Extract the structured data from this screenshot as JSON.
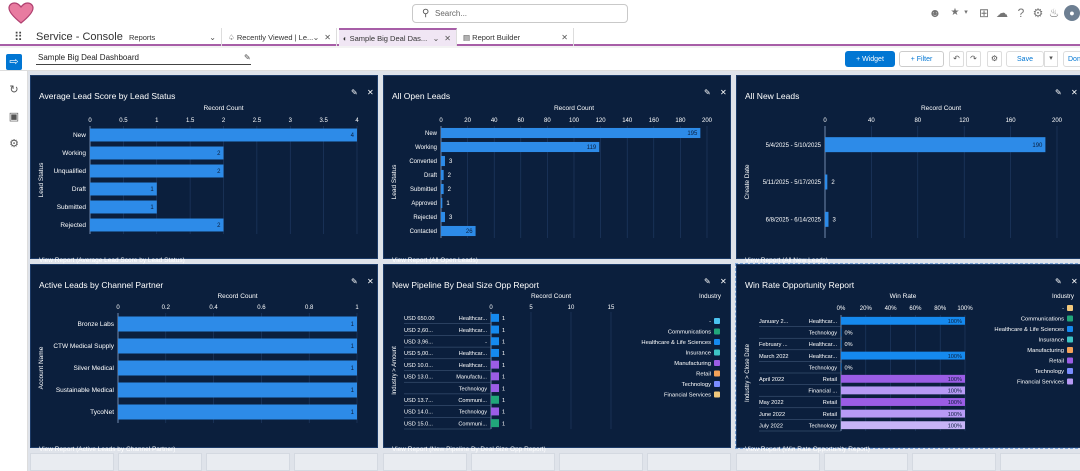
{
  "global": {
    "search_placeholder": "Search..."
  },
  "nav": {
    "app_name": "Service - Console",
    "tabs": [
      {
        "label": "Reports",
        "active": false
      },
      {
        "label": "Recently Viewed | Le...",
        "active": false
      },
      {
        "label": "Sample Big Deal Das...",
        "active": true
      },
      {
        "label": "Report Builder",
        "active": false
      }
    ]
  },
  "header": {
    "dashboard_title": "Sample Big Deal Dashboard",
    "widget_label": "+ Widget",
    "filter_label": "+ Filter",
    "save_label": "Save",
    "done_label": "Done"
  },
  "widgets": {
    "w1": {
      "title": "Average Lead Score by Lead Status",
      "link": "View Report (Average Lead Score by Lead Status)",
      "chart_data": {
        "type": "bar",
        "orientation": "horizontal",
        "xlabel": "Record Count",
        "ylabel": "Lead Status",
        "xlim": [
          0,
          4
        ],
        "ticks": [
          "0",
          "0.5",
          "1",
          "1.5",
          "2",
          "2.5",
          "3",
          "3.5",
          "4"
        ],
        "categories": [
          "New",
          "Working",
          "Unqualified",
          "Draft",
          "Submitted",
          "Rejected"
        ],
        "values": [
          4,
          2,
          2,
          1,
          1,
          2
        ]
      }
    },
    "w2": {
      "title": "All Open Leads",
      "link": "View Report (All Open Leads)",
      "chart_data": {
        "type": "bar",
        "orientation": "horizontal",
        "xlabel": "Record Count",
        "ylabel": "Lead Status",
        "xlim": [
          0,
          200
        ],
        "ticks": [
          "0",
          "20",
          "40",
          "60",
          "80",
          "100",
          "120",
          "140",
          "160",
          "180",
          "200"
        ],
        "categories": [
          "New",
          "Working",
          "Converted",
          "Draft",
          "Submitted",
          "Approved",
          "Rejected",
          "Contacted"
        ],
        "values": [
          195,
          119,
          3,
          2,
          2,
          1,
          3,
          26
        ]
      }
    },
    "w3": {
      "title": "All New Leads",
      "link": "View Report (All New Leads)",
      "chart_data": {
        "type": "bar",
        "orientation": "horizontal",
        "xlabel": "Record Count",
        "ylabel": "Create Date",
        "xlim": [
          0,
          200
        ],
        "ticks": [
          "0",
          "40",
          "80",
          "120",
          "160",
          "200"
        ],
        "categories": [
          "5/4/2025 - 5/10/2025",
          "5/11/2025 - 5/17/2025",
          "6/8/2025 - 6/14/2025"
        ],
        "values": [
          190,
          2,
          3
        ]
      }
    },
    "w4": {
      "title": "Active Leads by Channel Partner",
      "link": "View Report (Active Leads by Channel Partner)",
      "chart_data": {
        "type": "bar",
        "orientation": "horizontal",
        "xlabel": "Record Count",
        "ylabel": "Account Name",
        "xlim": [
          0,
          1
        ],
        "ticks": [
          "0",
          "0.2",
          "0.4",
          "0.6",
          "0.8",
          "1"
        ],
        "categories": [
          "Bronze Labs",
          "CTW Medical Supply",
          "Silver Medical",
          "Sustainable Medical",
          "TycoNet"
        ],
        "values": [
          1,
          1,
          1,
          1,
          1
        ]
      }
    },
    "w5": {
      "title": "New Pipeline By Deal Size Opp Report",
      "link": "View Report (New Pipeline By Deal Size Opp Report)",
      "chart_data": {
        "type": "bar",
        "orientation": "horizontal",
        "stacked": true,
        "xlabel": "Record Count",
        "ylabel": "Industry > Amount",
        "xlim": [
          0,
          15
        ],
        "ticks": [
          "0",
          "5",
          "10",
          "15"
        ],
        "rows": [
          {
            "amount": "USD 650.00",
            "industry": "Healthcar...",
            "value": 1,
            "color": "#1589ee"
          },
          {
            "amount": "USD 2,60...",
            "industry": "Healthcar...",
            "value": 1,
            "color": "#1589ee"
          },
          {
            "amount": "USD 3,96...",
            "industry": "-",
            "value": 1,
            "color": "#1589ee"
          },
          {
            "amount": "USD 5,00...",
            "industry": "Healthcar...",
            "value": 1,
            "color": "#1589ee"
          },
          {
            "amount": "USD 10.0...",
            "industry": "Healthcar...",
            "value": 1,
            "color": "#9b5de5"
          },
          {
            "amount": "USD 13.0...",
            "industry": "Manufactu...",
            "value": 1,
            "color": "#9b5de5"
          },
          {
            "amount": "",
            "industry": "Technology",
            "value": 1,
            "color": "#9b5de5"
          },
          {
            "amount": "USD 13.7...",
            "industry": "Communi...",
            "value": 1,
            "color": "#21a67a"
          },
          {
            "amount": "USD 14.0...",
            "industry": "Technology",
            "value": 1,
            "color": "#9b5de5"
          },
          {
            "amount": "USD 15.0...",
            "industry": "Communi...",
            "value": 1,
            "color": "#21a67a"
          }
        ],
        "legend_title": "Industry",
        "legend": [
          {
            "name": "-",
            "color": "#4bc3f0"
          },
          {
            "name": "Communications",
            "color": "#21a67a"
          },
          {
            "name": "Healthcare & Life Sciences",
            "color": "#1589ee"
          },
          {
            "name": "Insurance",
            "color": "#3ec5c5"
          },
          {
            "name": "Manufacturing",
            "color": "#9b5de5"
          },
          {
            "name": "Retail",
            "color": "#f4a259"
          },
          {
            "name": "Technology",
            "color": "#7b8cff"
          },
          {
            "name": "Financial Services",
            "color": "#f2c97d"
          }
        ]
      }
    },
    "w6": {
      "title": "Win Rate Opportunity Report",
      "link": "View Report (Win Rate Opportunity Report)",
      "chart_data": {
        "type": "bar",
        "orientation": "horizontal",
        "xlabel": "Win Rate",
        "ylabel": "Industry > Close Date",
        "xlim": [
          0,
          100
        ],
        "ticks": [
          "0%",
          "20%",
          "40%",
          "60%",
          "80%",
          "100%"
        ],
        "rows": [
          {
            "date": "January 2...",
            "industry": "Healthcar...",
            "value": 100,
            "label": "100%",
            "color": "#1589ee"
          },
          {
            "date": "",
            "industry": "Technology",
            "value": 0,
            "label": "0%",
            "color": "#1589ee"
          },
          {
            "date": "February ...",
            "industry": "Healthcar...",
            "value": 0,
            "label": "0%",
            "color": "#1589ee"
          },
          {
            "date": "March 2022",
            "industry": "Healthcar...",
            "value": 100,
            "label": "100%",
            "color": "#1589ee"
          },
          {
            "date": "",
            "industry": "Technology",
            "value": 0,
            "label": "0%",
            "color": "#1589ee"
          },
          {
            "date": "April 2022",
            "industry": "Retail",
            "value": 100,
            "label": "100%",
            "color": "#9b5de5"
          },
          {
            "date": "",
            "industry": "Financial ...",
            "value": 100,
            "label": "100%",
            "color": "#b79af5"
          },
          {
            "date": "May 2022",
            "industry": "Retail",
            "value": 100,
            "label": "100%",
            "color": "#9b5de5"
          },
          {
            "date": "June 2022",
            "industry": "Retail",
            "value": 100,
            "label": "100%",
            "color": "#b79af5"
          },
          {
            "date": "July 2022",
            "industry": "Technology",
            "value": 100,
            "label": "100%",
            "color": "#c7b4f7"
          }
        ],
        "legend_title": "Industry",
        "legend": [
          {
            "name": "-",
            "color": "#f2c97d"
          },
          {
            "name": "Communications",
            "color": "#21a67a"
          },
          {
            "name": "Healthcare & Life Sciences",
            "color": "#1589ee"
          },
          {
            "name": "Insurance",
            "color": "#3ec5c5"
          },
          {
            "name": "Manufacturing",
            "color": "#f4a259"
          },
          {
            "name": "Retail",
            "color": "#9b5de5"
          },
          {
            "name": "Technology",
            "color": "#7b8cff"
          },
          {
            "name": "Financial Services",
            "color": "#b79af5"
          }
        ]
      }
    }
  },
  "colors": {
    "bar": "#2d8be8",
    "widget_bg": "#0b1f3d",
    "accent": "#0176d3",
    "nav_accent": "#a75ea7"
  }
}
